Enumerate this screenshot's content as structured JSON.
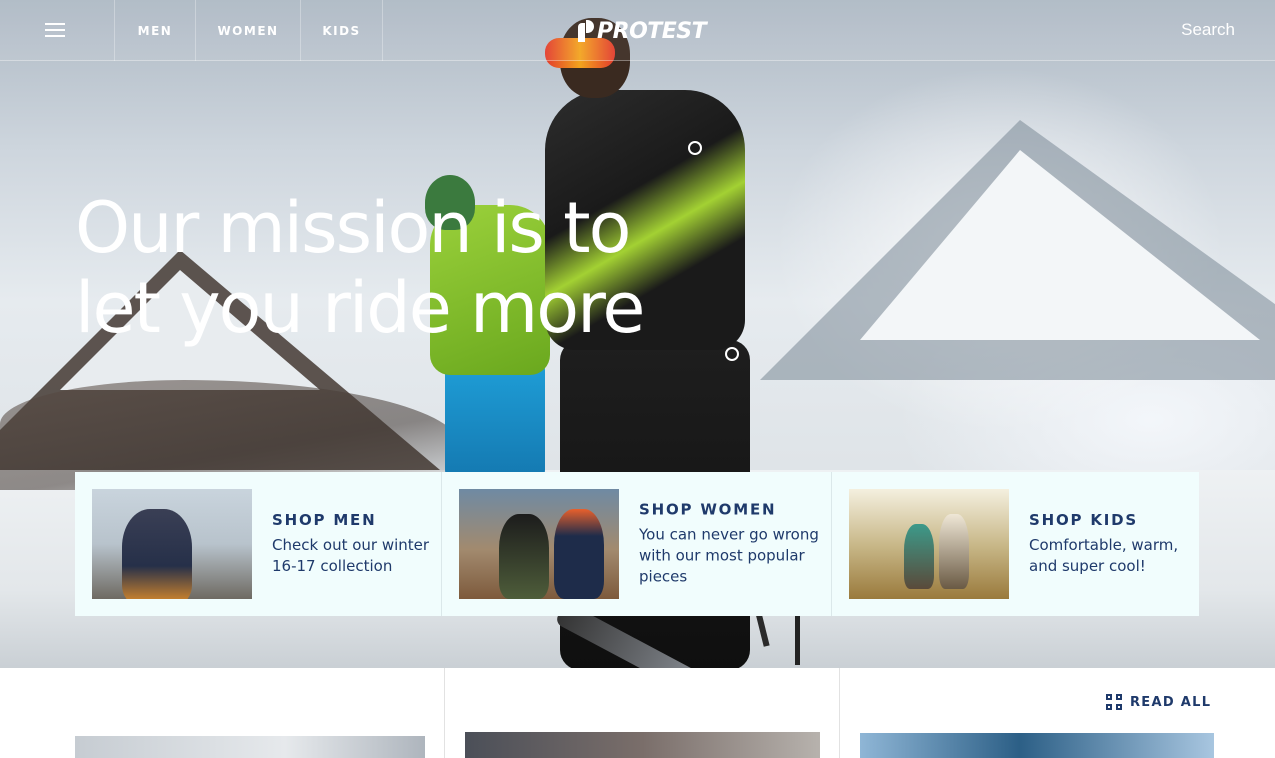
{
  "header": {
    "menu_icon": "hamburger-menu-icon",
    "nav": [
      {
        "label": "MEN"
      },
      {
        "label": "WOMEN"
      },
      {
        "label": "KIDS"
      }
    ],
    "logo_text": "PROTEST",
    "search_label": "Search"
  },
  "hero": {
    "headline_line1": "Our mission is to",
    "headline_line2": "let you ride more"
  },
  "shop_cards": [
    {
      "title": "SHOP MEN",
      "description": "Check out our winter 16-17 collection"
    },
    {
      "title": "SHOP WOMEN",
      "description": "You can never go wrong with our most popular pieces"
    },
    {
      "title": "SHOP KIDS",
      "description": "Comfortable, warm, and super cool!"
    }
  ],
  "articles": {
    "read_all_label": "READ ALL",
    "read_all_icon": "grid-icon"
  },
  "colors": {
    "brand_navy": "#1f3a6b",
    "card_background": "#f1fdfd"
  }
}
